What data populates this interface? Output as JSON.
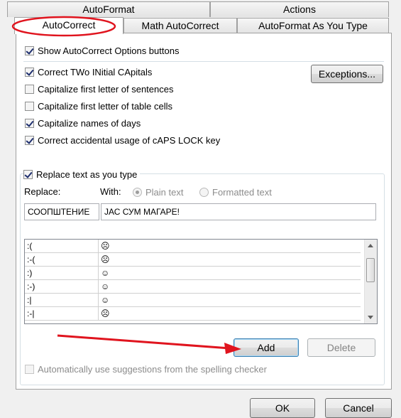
{
  "tabs": {
    "row1": [
      "AutoFormat",
      "Actions"
    ],
    "row2": [
      "AutoCorrect",
      "Math AutoCorrect",
      "AutoFormat As You Type"
    ]
  },
  "options": {
    "show_buttons": "Show AutoCorrect Options buttons",
    "two_initials": "Correct TWo INitial CApitals",
    "cap_sentences": "Capitalize first letter of sentences",
    "cap_table": "Capitalize first letter of table cells",
    "cap_days": "Capitalize names of days",
    "caps_lock": "Correct accidental usage of cAPS LOCK key",
    "exceptions_button": "Exceptions...",
    "replace_as_type": "Replace text as you type"
  },
  "replace": {
    "replace_label": "Replace:",
    "with_label": "With:",
    "plain_text": "Plain text",
    "formatted_text": "Formatted text",
    "replace_value": "СООПШТЕНИЕ",
    "with_value": "ЈАС СУМ МАГАРЕ!"
  },
  "list": {
    "rows": [
      {
        "key": ":(",
        "value": "☹"
      },
      {
        "key": ":-(",
        "value": "☹"
      },
      {
        "key": ":)",
        "value": "☺"
      },
      {
        "key": ":-)",
        "value": "☺"
      },
      {
        "key": ":|",
        "value": "☺"
      },
      {
        "key": ":-|",
        "value": "☹"
      }
    ]
  },
  "buttons": {
    "add": "Add",
    "delete": "Delete",
    "ok": "OK",
    "cancel": "Cancel"
  },
  "suggestions": "Automatically use suggestions from the spelling checker",
  "colors": {
    "highlight_ellipse": "#e0141e",
    "arrow": "#e0141e"
  }
}
